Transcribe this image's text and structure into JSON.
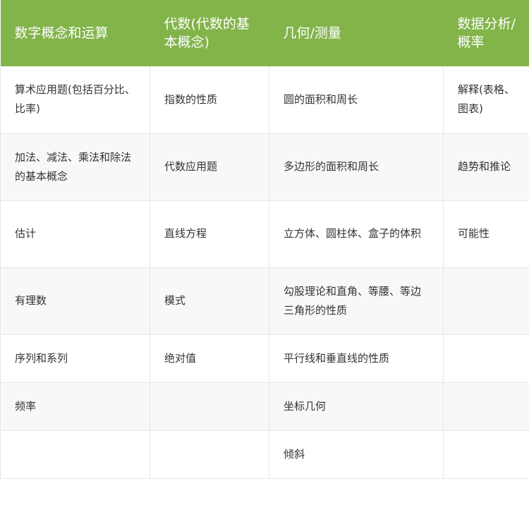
{
  "colors": {
    "header_bg": "#82b44a",
    "header_text": "#ffffff",
    "body_text": "#333333",
    "row_alt_bg": "#f8f8f8",
    "border": "#e6e6e6"
  },
  "table": {
    "headers": [
      "数字概念和运算",
      "代数(代数的基本概念)",
      "几何/测量",
      "数据分析/概率"
    ],
    "rows": [
      [
        "算术应用题(包括百分比、比率)",
        "指数的性质",
        "圆的面积和周长",
        "解释(表格、图表)"
      ],
      [
        "加法、减法、乘法和除法的基本概念",
        "代数应用题",
        "多边形的面积和周长",
        "趋势和推论"
      ],
      [
        "估计",
        "直线方程",
        "立方体、圆柱体、盒子的体积",
        "可能性"
      ],
      [
        "有理数",
        "模式",
        "勾股理论和直角、等腰、等边三角形的性质",
        ""
      ],
      [
        "序列和系列",
        "绝对值",
        "平行线和垂直线的性质",
        ""
      ],
      [
        "频率",
        "",
        "坐标几何",
        ""
      ],
      [
        "",
        "",
        "倾斜",
        ""
      ]
    ]
  }
}
